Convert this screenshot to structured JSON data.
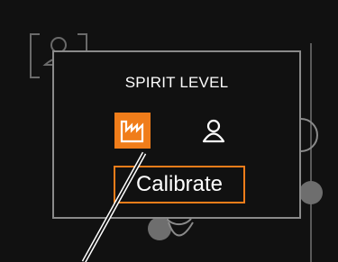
{
  "dialog": {
    "title": "SPIRIT LEVEL",
    "calibrate_label": "Calibrate",
    "modes": [
      {
        "name": "factory",
        "icon": "factory-icon",
        "selected": true
      },
      {
        "name": "user",
        "icon": "user-icon",
        "selected": false
      }
    ]
  },
  "colors": {
    "accent": "#f07d1a",
    "background": "#111111",
    "frame": "#8a8a8a",
    "text": "#ffffff"
  }
}
